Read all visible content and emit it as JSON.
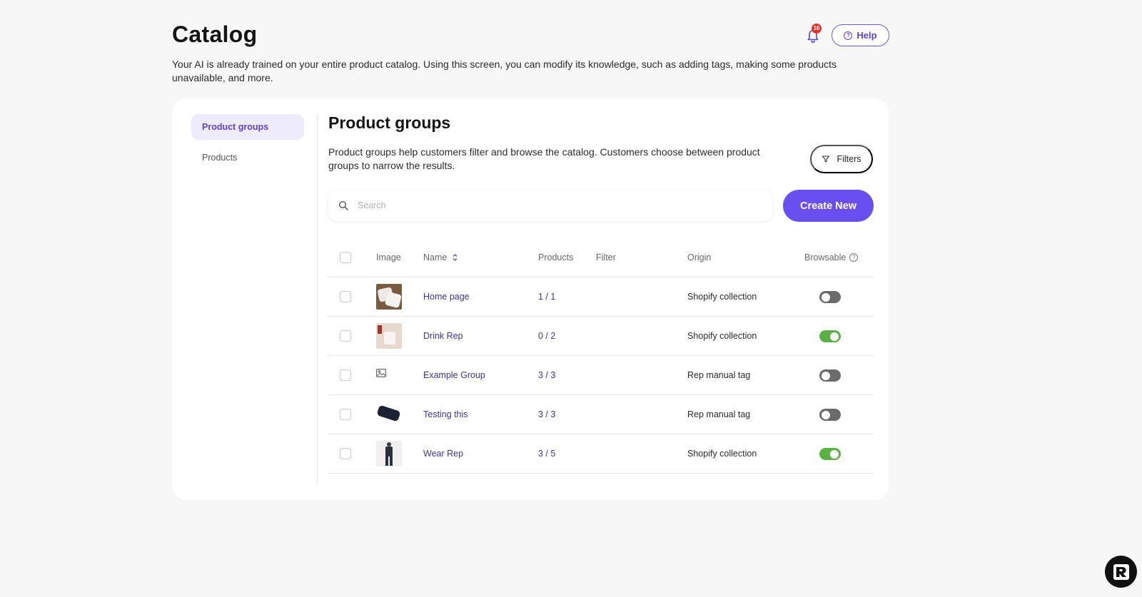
{
  "header": {
    "title": "Catalog",
    "notification_count": "16",
    "help_label": "Help",
    "description": "Your AI is already trained on your entire product catalog. Using this screen, you can modify its knowledge, such as adding tags, making some products unavailable, and more."
  },
  "sidebar": {
    "items": [
      {
        "label": "Product groups",
        "active": true
      },
      {
        "label": "Products",
        "active": false
      }
    ]
  },
  "main": {
    "title": "Product groups",
    "description": "Product groups help customers filter and browse the catalog. Customers choose between product groups to narrow the results.",
    "filters_label": "Filters",
    "search_placeholder": "Search",
    "create_label": "Create New"
  },
  "table": {
    "columns": {
      "image": "Image",
      "name": "Name",
      "products": "Products",
      "filter": "Filter",
      "origin": "Origin",
      "browsable": "Browsable"
    },
    "rows": [
      {
        "name": "Home page",
        "products": "1 / 1",
        "filter": "",
        "origin": "Shopify collection",
        "browsable": false,
        "image": "pillows-photo"
      },
      {
        "name": "Drink Rep",
        "products": "0 / 2",
        "filter": "",
        "origin": "Shopify collection",
        "browsable": true,
        "image": "drink-photo"
      },
      {
        "name": "Example Group",
        "products": "3 / 3",
        "filter": "",
        "origin": "Rep manual tag",
        "browsable": false,
        "image": "image-placeholder-icon"
      },
      {
        "name": "Testing this",
        "products": "3 / 3",
        "filter": "",
        "origin": "Rep manual tag",
        "browsable": false,
        "image": "device-photo"
      },
      {
        "name": "Wear Rep",
        "products": "3 / 5",
        "filter": "",
        "origin": "Shopify collection",
        "browsable": true,
        "image": "person-photo"
      }
    ]
  },
  "colors": {
    "accent": "#6a4ff0",
    "toggle_on": "#5bb046",
    "toggle_off": "#6b6b6b",
    "badge": "#e5322d"
  }
}
